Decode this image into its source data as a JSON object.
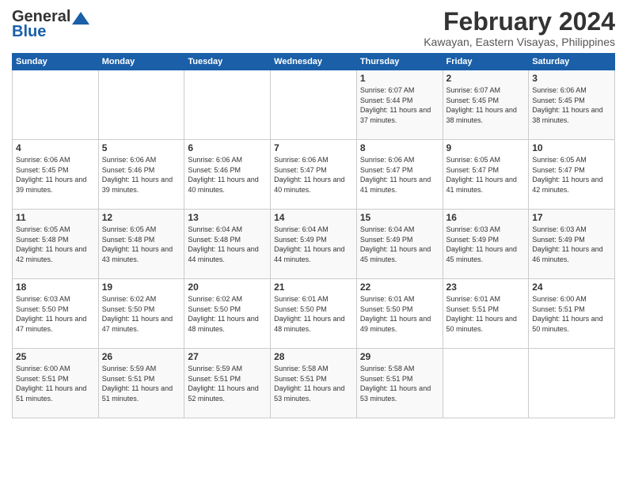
{
  "logo": {
    "line1": "General",
    "line2": "Blue"
  },
  "header": {
    "month_year": "February 2024",
    "location": "Kawayan, Eastern Visayas, Philippines"
  },
  "weekdays": [
    "Sunday",
    "Monday",
    "Tuesday",
    "Wednesday",
    "Thursday",
    "Friday",
    "Saturday"
  ],
  "weeks": [
    [
      {
        "day": "",
        "sunrise": "",
        "sunset": "",
        "daylight": ""
      },
      {
        "day": "",
        "sunrise": "",
        "sunset": "",
        "daylight": ""
      },
      {
        "day": "",
        "sunrise": "",
        "sunset": "",
        "daylight": ""
      },
      {
        "day": "",
        "sunrise": "",
        "sunset": "",
        "daylight": ""
      },
      {
        "day": "1",
        "sunrise": "Sunrise: 6:07 AM",
        "sunset": "Sunset: 5:44 PM",
        "daylight": "Daylight: 11 hours and 37 minutes."
      },
      {
        "day": "2",
        "sunrise": "Sunrise: 6:07 AM",
        "sunset": "Sunset: 5:45 PM",
        "daylight": "Daylight: 11 hours and 38 minutes."
      },
      {
        "day": "3",
        "sunrise": "Sunrise: 6:06 AM",
        "sunset": "Sunset: 5:45 PM",
        "daylight": "Daylight: 11 hours and 38 minutes."
      }
    ],
    [
      {
        "day": "4",
        "sunrise": "Sunrise: 6:06 AM",
        "sunset": "Sunset: 5:45 PM",
        "daylight": "Daylight: 11 hours and 39 minutes."
      },
      {
        "day": "5",
        "sunrise": "Sunrise: 6:06 AM",
        "sunset": "Sunset: 5:46 PM",
        "daylight": "Daylight: 11 hours and 39 minutes."
      },
      {
        "day": "6",
        "sunrise": "Sunrise: 6:06 AM",
        "sunset": "Sunset: 5:46 PM",
        "daylight": "Daylight: 11 hours and 40 minutes."
      },
      {
        "day": "7",
        "sunrise": "Sunrise: 6:06 AM",
        "sunset": "Sunset: 5:47 PM",
        "daylight": "Daylight: 11 hours and 40 minutes."
      },
      {
        "day": "8",
        "sunrise": "Sunrise: 6:06 AM",
        "sunset": "Sunset: 5:47 PM",
        "daylight": "Daylight: 11 hours and 41 minutes."
      },
      {
        "day": "9",
        "sunrise": "Sunrise: 6:05 AM",
        "sunset": "Sunset: 5:47 PM",
        "daylight": "Daylight: 11 hours and 41 minutes."
      },
      {
        "day": "10",
        "sunrise": "Sunrise: 6:05 AM",
        "sunset": "Sunset: 5:47 PM",
        "daylight": "Daylight: 11 hours and 42 minutes."
      }
    ],
    [
      {
        "day": "11",
        "sunrise": "Sunrise: 6:05 AM",
        "sunset": "Sunset: 5:48 PM",
        "daylight": "Daylight: 11 hours and 42 minutes."
      },
      {
        "day": "12",
        "sunrise": "Sunrise: 6:05 AM",
        "sunset": "Sunset: 5:48 PM",
        "daylight": "Daylight: 11 hours and 43 minutes."
      },
      {
        "day": "13",
        "sunrise": "Sunrise: 6:04 AM",
        "sunset": "Sunset: 5:48 PM",
        "daylight": "Daylight: 11 hours and 44 minutes."
      },
      {
        "day": "14",
        "sunrise": "Sunrise: 6:04 AM",
        "sunset": "Sunset: 5:49 PM",
        "daylight": "Daylight: 11 hours and 44 minutes."
      },
      {
        "day": "15",
        "sunrise": "Sunrise: 6:04 AM",
        "sunset": "Sunset: 5:49 PM",
        "daylight": "Daylight: 11 hours and 45 minutes."
      },
      {
        "day": "16",
        "sunrise": "Sunrise: 6:03 AM",
        "sunset": "Sunset: 5:49 PM",
        "daylight": "Daylight: 11 hours and 45 minutes."
      },
      {
        "day": "17",
        "sunrise": "Sunrise: 6:03 AM",
        "sunset": "Sunset: 5:49 PM",
        "daylight": "Daylight: 11 hours and 46 minutes."
      }
    ],
    [
      {
        "day": "18",
        "sunrise": "Sunrise: 6:03 AM",
        "sunset": "Sunset: 5:50 PM",
        "daylight": "Daylight: 11 hours and 47 minutes."
      },
      {
        "day": "19",
        "sunrise": "Sunrise: 6:02 AM",
        "sunset": "Sunset: 5:50 PM",
        "daylight": "Daylight: 11 hours and 47 minutes."
      },
      {
        "day": "20",
        "sunrise": "Sunrise: 6:02 AM",
        "sunset": "Sunset: 5:50 PM",
        "daylight": "Daylight: 11 hours and 48 minutes."
      },
      {
        "day": "21",
        "sunrise": "Sunrise: 6:01 AM",
        "sunset": "Sunset: 5:50 PM",
        "daylight": "Daylight: 11 hours and 48 minutes."
      },
      {
        "day": "22",
        "sunrise": "Sunrise: 6:01 AM",
        "sunset": "Sunset: 5:50 PM",
        "daylight": "Daylight: 11 hours and 49 minutes."
      },
      {
        "day": "23",
        "sunrise": "Sunrise: 6:01 AM",
        "sunset": "Sunset: 5:51 PM",
        "daylight": "Daylight: 11 hours and 50 minutes."
      },
      {
        "day": "24",
        "sunrise": "Sunrise: 6:00 AM",
        "sunset": "Sunset: 5:51 PM",
        "daylight": "Daylight: 11 hours and 50 minutes."
      }
    ],
    [
      {
        "day": "25",
        "sunrise": "Sunrise: 6:00 AM",
        "sunset": "Sunset: 5:51 PM",
        "daylight": "Daylight: 11 hours and 51 minutes."
      },
      {
        "day": "26",
        "sunrise": "Sunrise: 5:59 AM",
        "sunset": "Sunset: 5:51 PM",
        "daylight": "Daylight: 11 hours and 51 minutes."
      },
      {
        "day": "27",
        "sunrise": "Sunrise: 5:59 AM",
        "sunset": "Sunset: 5:51 PM",
        "daylight": "Daylight: 11 hours and 52 minutes."
      },
      {
        "day": "28",
        "sunrise": "Sunrise: 5:58 AM",
        "sunset": "Sunset: 5:51 PM",
        "daylight": "Daylight: 11 hours and 53 minutes."
      },
      {
        "day": "29",
        "sunrise": "Sunrise: 5:58 AM",
        "sunset": "Sunset: 5:51 PM",
        "daylight": "Daylight: 11 hours and 53 minutes."
      },
      {
        "day": "",
        "sunrise": "",
        "sunset": "",
        "daylight": ""
      },
      {
        "day": "",
        "sunrise": "",
        "sunset": "",
        "daylight": ""
      }
    ]
  ]
}
